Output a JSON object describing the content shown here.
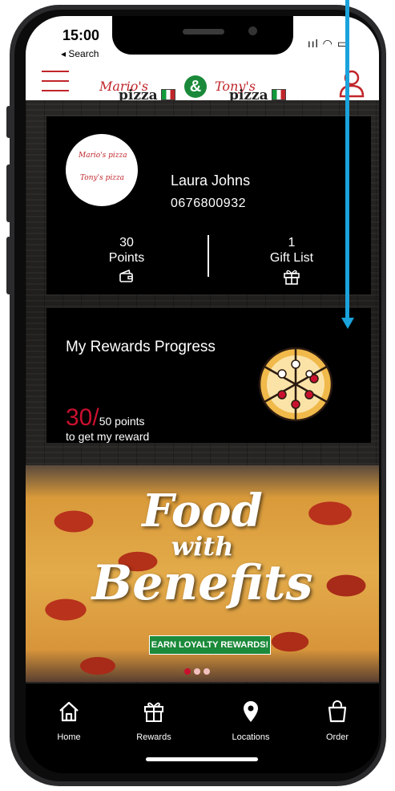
{
  "status_bar": {
    "time": "15:00",
    "back_label": "◂ Search",
    "signal": "ııl",
    "wifi": "◠",
    "battery": "▭"
  },
  "header": {
    "logo_left_script": "Mario's",
    "logo_left_word": "pizza",
    "logo_ampersand": "&",
    "logo_right_script": "Tony's",
    "logo_right_word": "pizza"
  },
  "profile": {
    "name": "Laura Johns",
    "phone": "0676800932",
    "points_value": "30",
    "points_label": "Points",
    "gift_value": "1",
    "gift_label": "Gift List",
    "avatar_logo_1": "Mario's pizza",
    "avatar_logo_2": "Tony's pizza"
  },
  "rewards": {
    "title": "My Rewards Progress",
    "current": "30/",
    "target": "50 points",
    "subtitle": "to get my reward",
    "progress_fraction": 0.6
  },
  "banner": {
    "line1": "Food",
    "line2": "with",
    "line3": "Benefits",
    "cta": "EARN LOYALTY REWARDS!",
    "slides": 4,
    "active_slide": 0
  },
  "tabs": [
    {
      "label": "Home",
      "icon": "home-icon"
    },
    {
      "label": "Rewards",
      "icon": "gift-icon"
    },
    {
      "label": "Locations",
      "icon": "location-pin-icon"
    },
    {
      "label": "Order",
      "icon": "shopping-bag-icon"
    }
  ],
  "colors": {
    "brand_red": "#c0252a",
    "accent_green": "#1a8a3a",
    "annotation_arrow": "#1aa3dc"
  }
}
